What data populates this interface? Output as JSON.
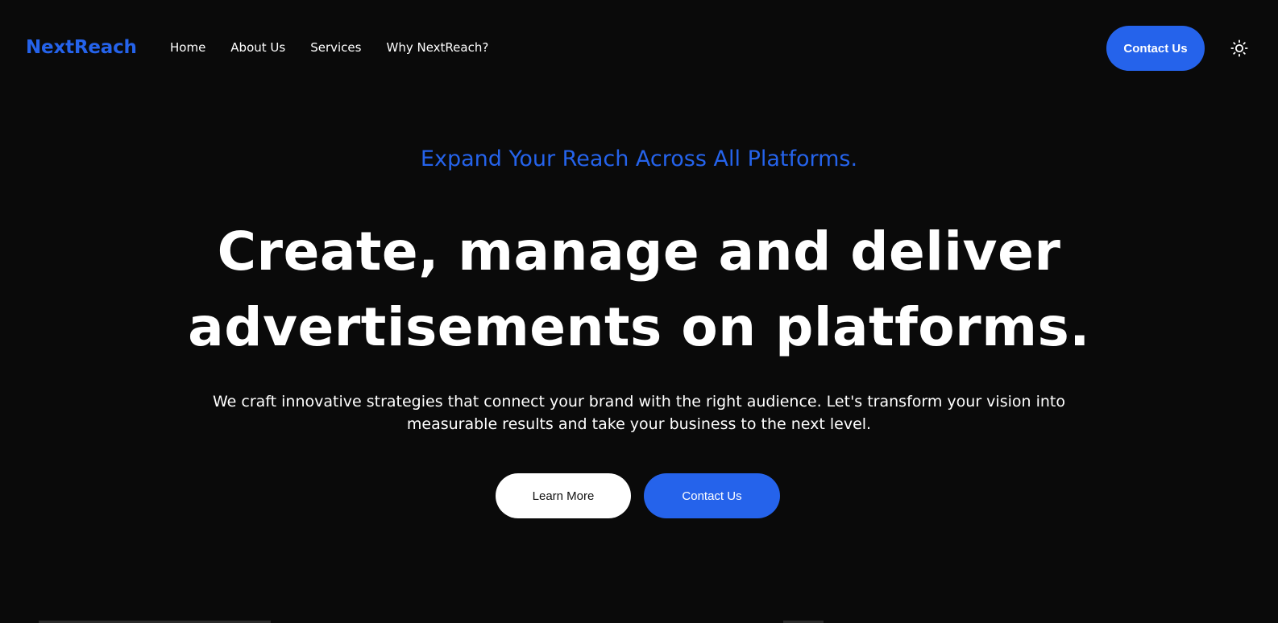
{
  "header": {
    "logo": "NextReach",
    "nav": [
      {
        "label": "Home"
      },
      {
        "label": "About Us"
      },
      {
        "label": "Services"
      },
      {
        "label": "Why NextReach?"
      }
    ],
    "cta_label": "Contact Us",
    "theme_toggle_icon": "sun-icon"
  },
  "hero": {
    "eyebrow": "Expand Your Reach Across All Platforms.",
    "headline_line1": "Create, manage and deliver",
    "headline_line2": "advertisements on platforms.",
    "subtext_line1": "We craft innovative strategies that connect your brand with the right audience. Let's transform your vision into",
    "subtext_line2": "measurable results and take your business to the next level.",
    "learn_more_label": "Learn More",
    "contact_label": "Contact Us"
  },
  "colors": {
    "background": "#0a0a0a",
    "accent": "#2563eb",
    "text": "#ffffff"
  }
}
